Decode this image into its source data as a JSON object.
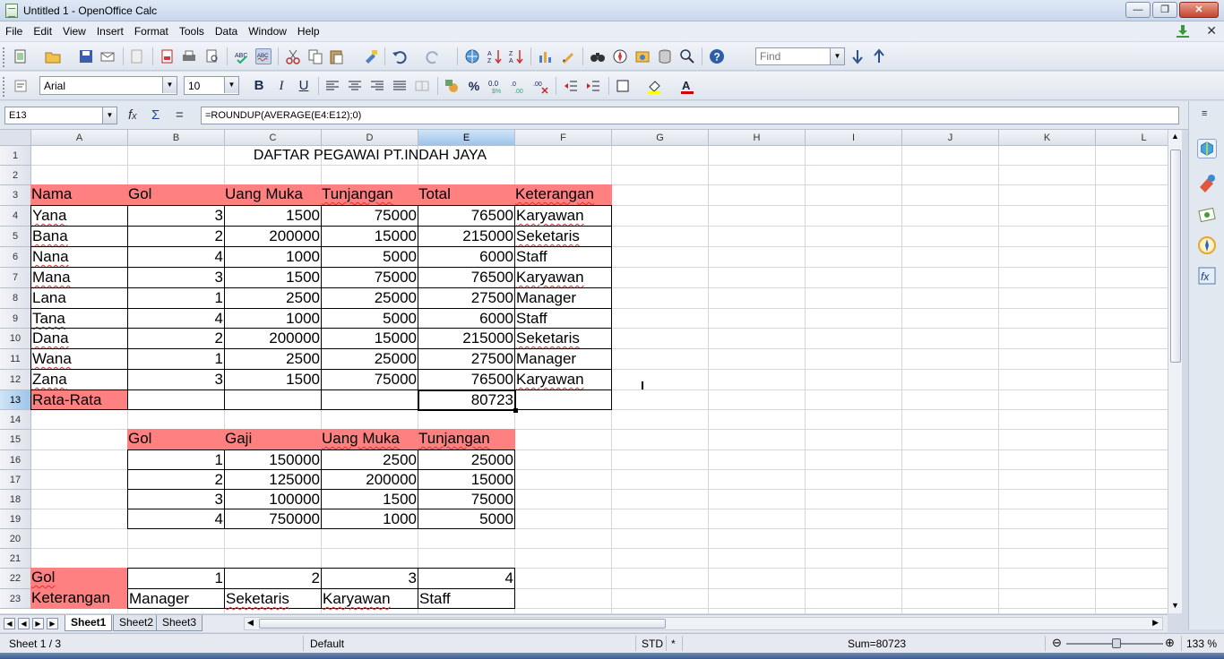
{
  "window": {
    "title": "Untitled 1 - OpenOffice Calc"
  },
  "menu": [
    "File",
    "Edit",
    "View",
    "Insert",
    "Format",
    "Tools",
    "Data",
    "Window",
    "Help"
  ],
  "toolbar": {
    "find_placeholder": "Find"
  },
  "format_bar": {
    "font_name": "Arial",
    "font_size": "10",
    "bold": "B",
    "italic": "I",
    "underline": "U",
    "percent": "%"
  },
  "formula_bar": {
    "cell_ref": "E13",
    "formula": "=ROUNDUP(AVERAGE(E4:E12);0)"
  },
  "columns": [
    "A",
    "B",
    "C",
    "D",
    "E",
    "F",
    "G",
    "H",
    "I",
    "J",
    "K",
    "L"
  ],
  "rows": [
    "1",
    "2",
    "3",
    "4",
    "5",
    "6",
    "7",
    "8",
    "9",
    "10",
    "11",
    "12",
    "13",
    "14",
    "15",
    "16",
    "17",
    "18",
    "19",
    "20",
    "21",
    "22",
    "23"
  ],
  "selected": {
    "column": "E",
    "row": "13"
  },
  "sheet": {
    "title": "DAFTAR PEGAWAI PT.INDAH JAYA",
    "main_headers": [
      "Nama",
      "Gol",
      "Uang Muka",
      "Tunjangan",
      "Total",
      "Keterangan"
    ],
    "main_rows": [
      [
        "Yana",
        "3",
        "1500",
        "75000",
        "76500",
        "Karyawan"
      ],
      [
        "Bana",
        "2",
        "200000",
        "15000",
        "215000",
        "Seketaris"
      ],
      [
        "Nana",
        "4",
        "1000",
        "5000",
        "6000",
        "Staff"
      ],
      [
        "Mana",
        "3",
        "1500",
        "75000",
        "76500",
        "Karyawan"
      ],
      [
        "Lana",
        "1",
        "2500",
        "25000",
        "27500",
        "Manager"
      ],
      [
        "Tana",
        "4",
        "1000",
        "5000",
        "6000",
        "Staff"
      ],
      [
        "Dana",
        "2",
        "200000",
        "15000",
        "215000",
        "Seketaris"
      ],
      [
        "Wana",
        "1",
        "2500",
        "25000",
        "27500",
        "Manager"
      ],
      [
        "Zana",
        "3",
        "1500",
        "75000",
        "76500",
        "Karyawan"
      ]
    ],
    "average_label": "Rata-Rata",
    "average_value": "80723",
    "ref_headers": [
      "Gol",
      "Gaji",
      "Uang Muka",
      "Tunjangan"
    ],
    "ref_rows": [
      [
        "1",
        "150000",
        "2500",
        "25000"
      ],
      [
        "2",
        "125000",
        "200000",
        "15000"
      ],
      [
        "3",
        "100000",
        "1500",
        "75000"
      ],
      [
        "4",
        "750000",
        "1000",
        "5000"
      ]
    ],
    "lookup_gol_label": "Gol",
    "lookup_gol_values": [
      "1",
      "2",
      "3",
      "4"
    ],
    "lookup_ket_label": "Keterangan",
    "lookup_ket_values": [
      "Manager",
      "Seketaris",
      "Karyawan",
      "Staff"
    ]
  },
  "tabs": [
    "Sheet1",
    "Sheet2",
    "Sheet3"
  ],
  "status": {
    "sheet": "Sheet 1 / 3",
    "style": "Default",
    "mode": "STD",
    "modified": "*",
    "sum": "Sum=80723",
    "zoom": "133 %"
  },
  "colors": {
    "header_fill": "#ff8080",
    "selection_header": "#9cc4ea"
  }
}
